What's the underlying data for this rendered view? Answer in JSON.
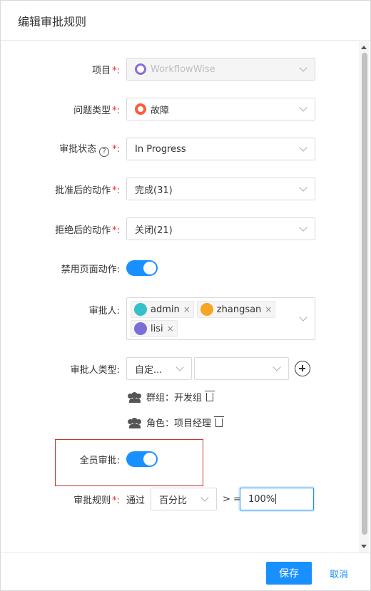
{
  "dialog": {
    "title": "编辑审批规则"
  },
  "form": {
    "project": {
      "label": "项目",
      "required": "*:",
      "value": "WorkflowWise"
    },
    "issue_type": {
      "label": "问题类型",
      "required": "*:",
      "value": "故障"
    },
    "approval_status": {
      "label": "审批状态",
      "help": "?",
      "required": "*:",
      "value": "In Progress"
    },
    "after_approve": {
      "label": "批准后的动作",
      "required": "*:",
      "value": "完成(31)"
    },
    "after_reject": {
      "label": "拒绝后的动作",
      "required": "*:",
      "value": "关闭(21)"
    },
    "disable_page_action": {
      "label": "禁用页面动作:",
      "on": true
    },
    "approvers": {
      "label": "审批人:",
      "tags": [
        {
          "name": "admin",
          "close": "×"
        },
        {
          "name": "zhangsan",
          "close": "×"
        },
        {
          "name": "lisi",
          "close": "×"
        }
      ]
    },
    "approver_type": {
      "label": "审批人类型:",
      "type_value": "自定...",
      "second_value": "",
      "entries": [
        {
          "text": "群组：开发组"
        },
        {
          "text": "角色：项目经理"
        }
      ]
    },
    "all_approve": {
      "label": "全员审批:",
      "on": true
    },
    "approval_rule": {
      "label": "审批规则",
      "required": "*:",
      "prefix": "通过",
      "mode": "百分比",
      "operator": "> =",
      "value": "100%"
    }
  },
  "footer": {
    "save_label": "保存",
    "cancel_label": "取消"
  },
  "colors": {
    "primary": "#1890ff",
    "required": "#f5222d",
    "highlight_border": "#c9332b"
  }
}
